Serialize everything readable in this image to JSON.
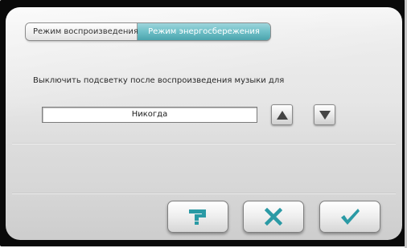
{
  "tabs": {
    "playback_label": "Режим воспроизведения",
    "power_saving_label": "Режим энергосбережения"
  },
  "setting": {
    "label": "Выключить подсветку после воспроизведения музыки для",
    "value": "Никогда"
  },
  "icons": {
    "up": "triangle-up-icon",
    "down": "triangle-down-icon",
    "help": "help-icon",
    "cancel": "close-icon",
    "ok": "checkmark-icon"
  },
  "colors": {
    "active_tab": "#6ebfc7",
    "help_icon": "#2a9aa5",
    "cancel_icon": "#2a9aa5",
    "ok_icon": "#2a9aa5",
    "arrow_icon": "#444444"
  }
}
